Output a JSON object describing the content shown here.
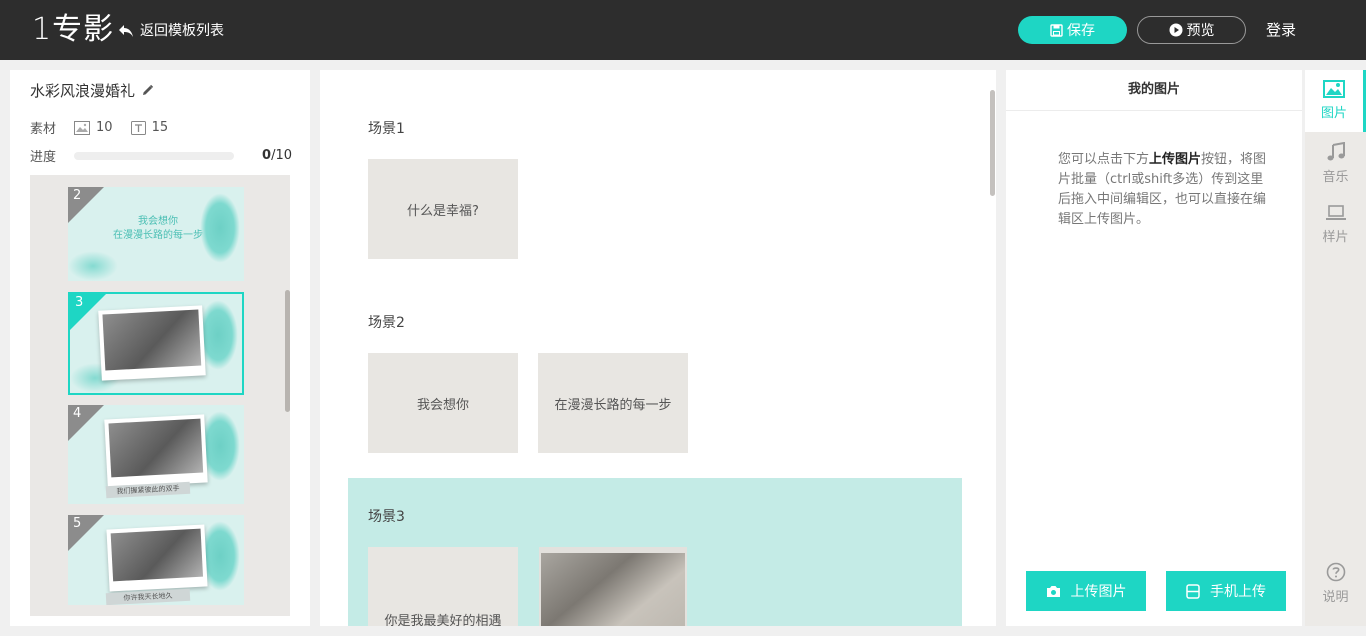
{
  "header": {
    "logo": "1专影",
    "back_label": "返回模板列表",
    "save_label": "保存",
    "preview_label": "预览",
    "login_label": "登录"
  },
  "project": {
    "title": "水彩风浪漫婚礼",
    "stats_label": "素材",
    "image_count": "10",
    "text_count": "15",
    "progress_label": "进度",
    "progress_value": 0,
    "progress_done": "0",
    "progress_total": "/10"
  },
  "thumbnails": [
    {
      "num": "2",
      "caption_line1": "我会想你",
      "caption_line2": "在漫漫长路的每一步"
    },
    {
      "num": "3"
    },
    {
      "num": "4",
      "ribbon": "我们握紧彼此的双手"
    },
    {
      "num": "5",
      "ribbon": "你许我天长地久"
    }
  ],
  "scenes": [
    {
      "label": "场景1",
      "items": [
        "什么是幸福?"
      ]
    },
    {
      "label": "场景2",
      "items": [
        "我会想你",
        "在漫漫长路的每一步"
      ]
    },
    {
      "label": "场景3",
      "items": [
        "你是我最美好的相遇"
      ]
    }
  ],
  "right_panel": {
    "title": "我的图片",
    "help_prefix": "您可以点击下方",
    "help_bold": "上传图片",
    "help_suffix": "按钮，将图片批量（ctrl或shift多选）传到这里后拖入中间编辑区，也可以直接在编辑区上传图片。",
    "upload_label": "上传图片",
    "mobile_upload_label": "手机上传"
  },
  "tabs": {
    "images": "图片",
    "music": "音乐",
    "sample": "样片",
    "help": "说明"
  },
  "colors": {
    "accent": "#1ed6c4",
    "header_bg": "#2d2d2d",
    "scene_highlight": "#c4ebe6"
  }
}
